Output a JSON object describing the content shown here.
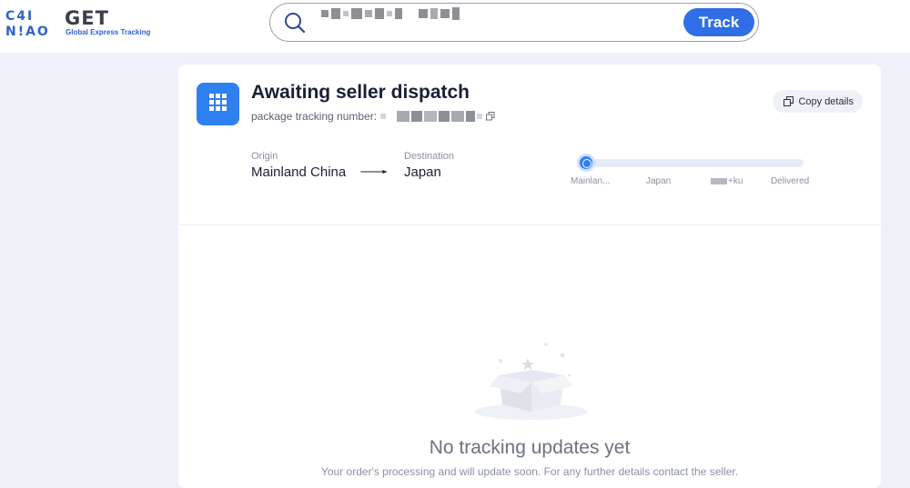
{
  "header": {
    "logo_line1": "CAINIAO",
    "logo_get": "GET",
    "logo_tagline": "Global Express Tracking",
    "search_value_masked": true,
    "track_label": "Track",
    "search_icon": "search-icon"
  },
  "status": {
    "icon": "package-grid-icon",
    "title": "Awaiting seller dispatch",
    "tracking_label": "package tracking number:",
    "copy_details_label": "Copy details"
  },
  "route": {
    "origin_label": "Origin",
    "origin_value": "Mainland China",
    "destination_label": "Destination",
    "destination_value": "Japan"
  },
  "progress": {
    "stages": [
      "Mainlan...",
      "Japan",
      "+ku",
      "Delivered"
    ],
    "current_stage_index": 0
  },
  "empty": {
    "title": "No tracking updates yet",
    "subtitle": "Your order's processing and will update soon. For any further details contact the seller."
  },
  "colors": {
    "accent": "#2f6ee6",
    "status_icon_bg": "#2f80f0",
    "page_bg": "#eef1f8"
  }
}
